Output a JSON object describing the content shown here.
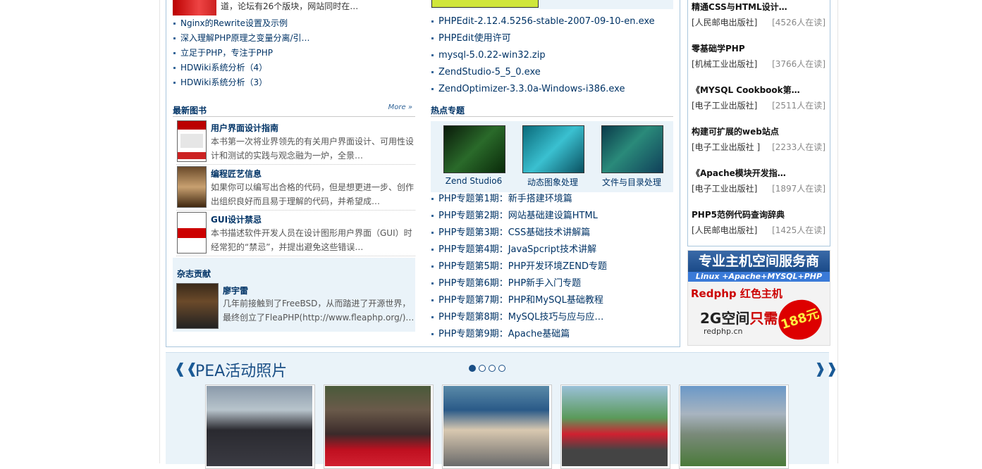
{
  "left": {
    "top_text": "道，论坛有26个版块，网站同时在…",
    "links": [
      "Nginx的Rewrite设置及示例",
      "深入理解PHP原理之变量分离/引…",
      "立足于PHP，专注于PHP",
      "HDWiki系统分析（4）",
      "HDWiki系统分析（3）"
    ],
    "books_header": "最新图书",
    "more": "More »",
    "books": [
      {
        "title": "用户界面设计指南",
        "desc": "本书第一次将业界领先的有关用户界面设计、可用性设计和测试的实践与观念融为一炉，全景…"
      },
      {
        "title": "编程匠艺信息",
        "desc": "如果你可以编写出合格的代码，但是想更进一步、创作出组织良好而且易于理解的代码，并希望成…"
      },
      {
        "title": "GUI设计禁忌",
        "desc": "本书描述软件开发人员在设计图形用户界面（GUI）时经常犯的“禁忌”，并提出避免这些错误…"
      }
    ],
    "magazine": {
      "header": "杂志贡献",
      "name": "廖宇雷",
      "desc": "几年前接触到了FreeBSD，从而踏进了开源世界，最终创立了FleaPHP(http://www.fleaphp.org/)…"
    }
  },
  "mid": {
    "downloads": [
      "PHPEdit-2.12.4.5256-stable-2007-09-10-en.exe",
      "PHPEdit使用许可",
      "mysql-5.0.22-win32.zip",
      "ZendStudio-5_5_0.exe",
      "ZendOptimizer-3.3.0a-Windows-i386.exe"
    ],
    "topics_header": "热点专题",
    "topics": [
      "Zend Studio6",
      "动态图象处理",
      "文件与目录处理"
    ],
    "topic_links": [
      "PHP专题第1期：新手搭建环境篇",
      "PHP专题第2期：网站基础建设篇HTML",
      "PHP专题第3期：CSS基础技术讲解篇",
      "PHP专题第4期：JavaSpcript技术讲解",
      "PHP专题第5期：PHP开发环境ZEND专题",
      "PHP专题第6期：PHP新手入门专题",
      "PHP专题第7期：PHP和MySQL基础教程",
      "PHP专题第8期：MySQL技巧与应与应…",
      "PHP专题第9期：Apache基础篇"
    ]
  },
  "right": {
    "books": [
      {
        "title": "精通CSS与HTML设计…",
        "publisher": "[人民邮电出版社]",
        "count": "4526人在读"
      },
      {
        "title": "零基础学PHP",
        "publisher": "[机械工业出版社]",
        "count": "3766人在读"
      },
      {
        "title": "《MYSQL Cookbook第…",
        "publisher": "[电子工业出版社]",
        "count": "2511人在读"
      },
      {
        "title": "构建可扩展的web站点",
        "publisher": "[电子工业出版社 ]",
        "count": "2233人在读"
      },
      {
        "title": "《Apache模块开发指…",
        "publisher": "[电子工业出版社]",
        "count": "1897人在读"
      },
      {
        "title": "PHP5范例代码查询辞典",
        "publisher": "[人民邮电出版社]",
        "count": "1425人在读"
      }
    ],
    "ad": {
      "line1": "专业主机空间服务商",
      "line2": "Linux +Apache+MYSQL+PHP",
      "line3": "Redphp 红色主机",
      "line4a": "2G空间",
      "line4b": "只需",
      "badge": "188元",
      "domain": "redphp.cn"
    }
  },
  "photos": {
    "title": "PEA活动照片"
  },
  "colors": {
    "link": "#003366",
    "panel": "#eaf3f9",
    "border": "#a9c6dd"
  }
}
